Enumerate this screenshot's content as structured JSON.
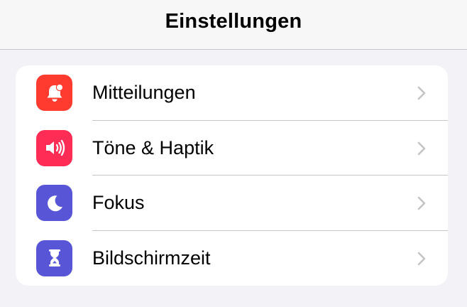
{
  "header": {
    "title": "Einstellungen"
  },
  "settings": {
    "items": [
      {
        "label": "Mitteilungen",
        "icon": "bell-icon",
        "color": "#ff3b30"
      },
      {
        "label": "Töne & Haptik",
        "icon": "speaker-icon",
        "color": "#ff2d55"
      },
      {
        "label": "Fokus",
        "icon": "moon-icon",
        "color": "#5856d6"
      },
      {
        "label": "Bildschirmzeit",
        "icon": "hourglass-icon",
        "color": "#5856d6"
      }
    ]
  }
}
